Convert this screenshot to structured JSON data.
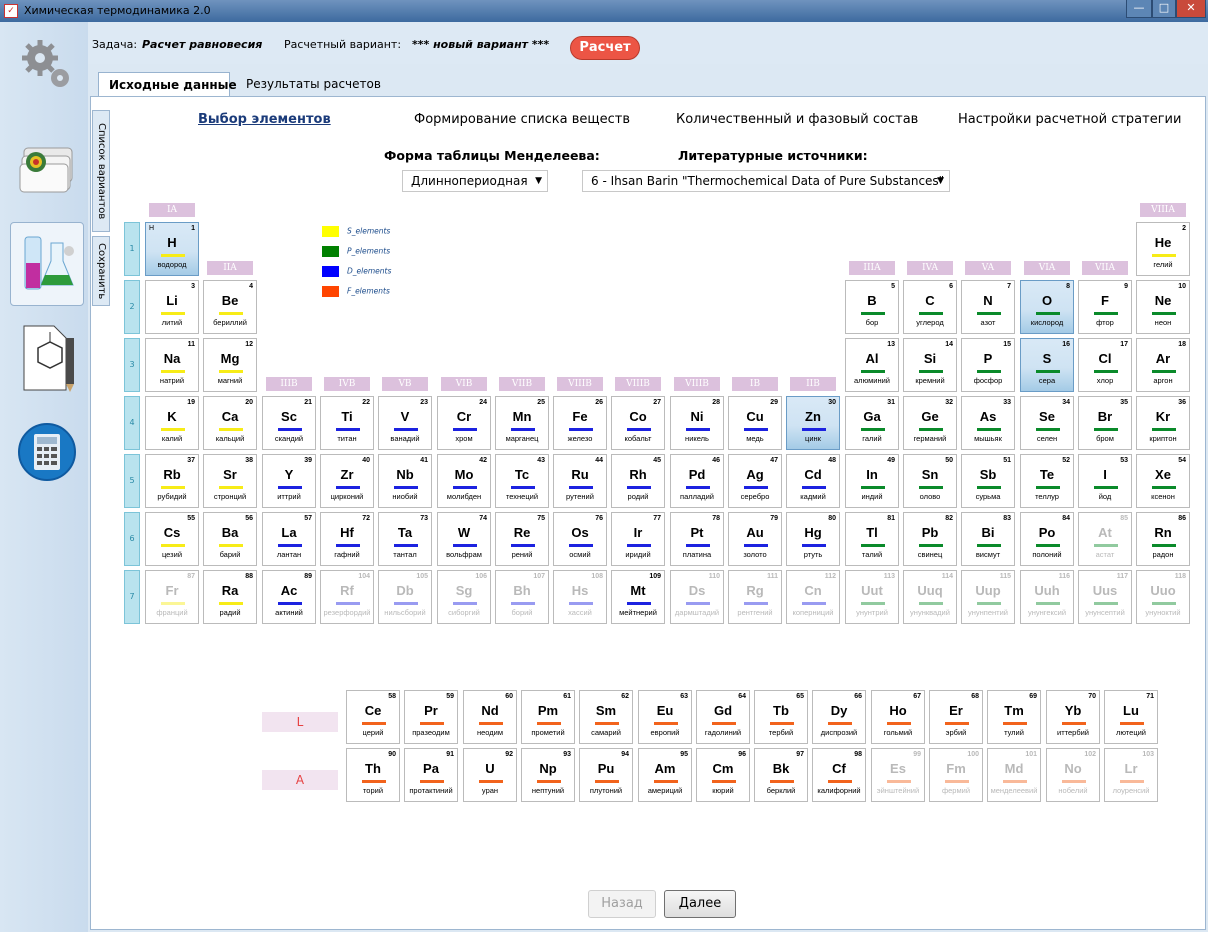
{
  "window": {
    "title": "Химическая термодинамика 2.0",
    "controls": [
      "—",
      "□",
      "✕"
    ]
  },
  "header": {
    "task_label": "Задача:",
    "task_value": "Расчет равновесия",
    "variant_label": "Расчетный вариант:",
    "variant_value": "*** новый вариант ***",
    "calc_button": "Расчет"
  },
  "sidebar": {
    "items": [
      {
        "icon": "gears-icon"
      },
      {
        "icon": "database-icon"
      },
      {
        "icon": "flasks-icon",
        "active": true
      },
      {
        "icon": "molecule-pencil-icon"
      },
      {
        "icon": "calculator-icon"
      }
    ]
  },
  "tabs": [
    {
      "label": "Исходные данные",
      "selected": true
    },
    {
      "label": "Результаты расчетов"
    }
  ],
  "side_tabs": [
    "Список вариантов",
    "Сохранить"
  ],
  "sections": [
    {
      "label": "Выбор элементов",
      "active": true
    },
    {
      "label": "Формирование списка веществ"
    },
    {
      "label": "Количественный и фазовый состав"
    },
    {
      "label": "Настройки расчетной стратегии"
    }
  ],
  "table_form": {
    "label": "Форма таблицы Менделеева:",
    "value": "Длиннопериодная"
  },
  "literature": {
    "label": "Литературные источники:",
    "value": "6 - Ihsan Barin \"Thermochemical Data of Pure Substances\""
  },
  "legend": [
    {
      "label": "S_elements",
      "color": "#ffff00"
    },
    {
      "label": "P_elements",
      "color": "#008000"
    },
    {
      "label": "D_elements",
      "color": "#0000ff"
    },
    {
      "label": "F_elements",
      "color": "#ff4500"
    }
  ],
  "colors": {
    "s": "#f7ec17",
    "p": "#0a8a2a",
    "d": "#1c22e0",
    "f": "#f2631c"
  },
  "groups": {
    "main": [
      "IA",
      "IIA",
      "IIIA",
      "IVA",
      "VA",
      "VIA",
      "VIIA",
      "VIIIA"
    ],
    "trans": [
      "IIIB",
      "IVB",
      "VB",
      "VIB",
      "VIIB",
      "VIIIB",
      "VIIIB",
      "VIIIB",
      "IB",
      "IIB"
    ]
  },
  "periods": [
    "1",
    "2",
    "3",
    "4",
    "5",
    "6",
    "7"
  ],
  "series": [
    "L",
    "A"
  ],
  "h_label": "H",
  "elements": [
    {
      "n": 1,
      "s": "H",
      "name": "водород",
      "p": 1,
      "g": 1,
      "b": "s",
      "sel": true
    },
    {
      "n": 2,
      "s": "He",
      "name": "гелий",
      "p": 1,
      "g": 18,
      "b": "s"
    },
    {
      "n": 3,
      "s": "Li",
      "name": "литий",
      "p": 2,
      "g": 1,
      "b": "s"
    },
    {
      "n": 4,
      "s": "Be",
      "name": "бериллий",
      "p": 2,
      "g": 2,
      "b": "s"
    },
    {
      "n": 5,
      "s": "B",
      "name": "бор",
      "p": 2,
      "g": 13,
      "b": "p"
    },
    {
      "n": 6,
      "s": "C",
      "name": "углерод",
      "p": 2,
      "g": 14,
      "b": "p"
    },
    {
      "n": 7,
      "s": "N",
      "name": "азот",
      "p": 2,
      "g": 15,
      "b": "p"
    },
    {
      "n": 8,
      "s": "O",
      "name": "кислород",
      "p": 2,
      "g": 16,
      "b": "p",
      "sel": true
    },
    {
      "n": 9,
      "s": "F",
      "name": "фтор",
      "p": 2,
      "g": 17,
      "b": "p"
    },
    {
      "n": 10,
      "s": "Ne",
      "name": "неон",
      "p": 2,
      "g": 18,
      "b": "p"
    },
    {
      "n": 11,
      "s": "Na",
      "name": "натрий",
      "p": 3,
      "g": 1,
      "b": "s"
    },
    {
      "n": 12,
      "s": "Mg",
      "name": "магний",
      "p": 3,
      "g": 2,
      "b": "s"
    },
    {
      "n": 13,
      "s": "Al",
      "name": "алюминий",
      "p": 3,
      "g": 13,
      "b": "p"
    },
    {
      "n": 14,
      "s": "Si",
      "name": "кремний",
      "p": 3,
      "g": 14,
      "b": "p"
    },
    {
      "n": 15,
      "s": "P",
      "name": "фосфор",
      "p": 3,
      "g": 15,
      "b": "p"
    },
    {
      "n": 16,
      "s": "S",
      "name": "сера",
      "p": 3,
      "g": 16,
      "b": "p",
      "sel": true
    },
    {
      "n": 17,
      "s": "Cl",
      "name": "хлор",
      "p": 3,
      "g": 17,
      "b": "p"
    },
    {
      "n": 18,
      "s": "Ar",
      "name": "аргон",
      "p": 3,
      "g": 18,
      "b": "p"
    },
    {
      "n": 19,
      "s": "K",
      "name": "калий",
      "p": 4,
      "g": 1,
      "b": "s"
    },
    {
      "n": 20,
      "s": "Ca",
      "name": "кальций",
      "p": 4,
      "g": 2,
      "b": "s"
    },
    {
      "n": 21,
      "s": "Sc",
      "name": "скандий",
      "p": 4,
      "g": 3,
      "b": "d"
    },
    {
      "n": 22,
      "s": "Ti",
      "name": "титан",
      "p": 4,
      "g": 4,
      "b": "d"
    },
    {
      "n": 23,
      "s": "V",
      "name": "ванадий",
      "p": 4,
      "g": 5,
      "b": "d"
    },
    {
      "n": 24,
      "s": "Cr",
      "name": "хром",
      "p": 4,
      "g": 6,
      "b": "d"
    },
    {
      "n": 25,
      "s": "Mn",
      "name": "марганец",
      "p": 4,
      "g": 7,
      "b": "d"
    },
    {
      "n": 26,
      "s": "Fe",
      "name": "железо",
      "p": 4,
      "g": 8,
      "b": "d"
    },
    {
      "n": 27,
      "s": "Co",
      "name": "кобальт",
      "p": 4,
      "g": 9,
      "b": "d"
    },
    {
      "n": 28,
      "s": "Ni",
      "name": "никель",
      "p": 4,
      "g": 10,
      "b": "d"
    },
    {
      "n": 29,
      "s": "Cu",
      "name": "медь",
      "p": 4,
      "g": 11,
      "b": "d"
    },
    {
      "n": 30,
      "s": "Zn",
      "name": "цинк",
      "p": 4,
      "g": 12,
      "b": "d",
      "sel": true
    },
    {
      "n": 31,
      "s": "Ga",
      "name": "галий",
      "p": 4,
      "g": 13,
      "b": "p"
    },
    {
      "n": 32,
      "s": "Ge",
      "name": "германий",
      "p": 4,
      "g": 14,
      "b": "p"
    },
    {
      "n": 33,
      "s": "As",
      "name": "мышьяк",
      "p": 4,
      "g": 15,
      "b": "p"
    },
    {
      "n": 34,
      "s": "Se",
      "name": "селен",
      "p": 4,
      "g": 16,
      "b": "p"
    },
    {
      "n": 35,
      "s": "Br",
      "name": "бром",
      "p": 4,
      "g": 17,
      "b": "p"
    },
    {
      "n": 36,
      "s": "Kr",
      "name": "криптон",
      "p": 4,
      "g": 18,
      "b": "p"
    },
    {
      "n": 37,
      "s": "Rb",
      "name": "рубидий",
      "p": 5,
      "g": 1,
      "b": "s"
    },
    {
      "n": 38,
      "s": "Sr",
      "name": "стронций",
      "p": 5,
      "g": 2,
      "b": "s"
    },
    {
      "n": 39,
      "s": "Y",
      "name": "иттрий",
      "p": 5,
      "g": 3,
      "b": "d"
    },
    {
      "n": 40,
      "s": "Zr",
      "name": "цирконий",
      "p": 5,
      "g": 4,
      "b": "d"
    },
    {
      "n": 41,
      "s": "Nb",
      "name": "ниобий",
      "p": 5,
      "g": 5,
      "b": "d"
    },
    {
      "n": 42,
      "s": "Mo",
      "name": "молибден",
      "p": 5,
      "g": 6,
      "b": "d"
    },
    {
      "n": 43,
      "s": "Tc",
      "name": "технеций",
      "p": 5,
      "g": 7,
      "b": "d"
    },
    {
      "n": 44,
      "s": "Ru",
      "name": "рутений",
      "p": 5,
      "g": 8,
      "b": "d"
    },
    {
      "n": 45,
      "s": "Rh",
      "name": "родий",
      "p": 5,
      "g": 9,
      "b": "d"
    },
    {
      "n": 46,
      "s": "Pd",
      "name": "палладий",
      "p": 5,
      "g": 10,
      "b": "d"
    },
    {
      "n": 47,
      "s": "Ag",
      "name": "серебро",
      "p": 5,
      "g": 11,
      "b": "d"
    },
    {
      "n": 48,
      "s": "Cd",
      "name": "кадмий",
      "p": 5,
      "g": 12,
      "b": "d"
    },
    {
      "n": 49,
      "s": "In",
      "name": "индий",
      "p": 5,
      "g": 13,
      "b": "p"
    },
    {
      "n": 50,
      "s": "Sn",
      "name": "олово",
      "p": 5,
      "g": 14,
      "b": "p"
    },
    {
      "n": 51,
      "s": "Sb",
      "name": "сурьма",
      "p": 5,
      "g": 15,
      "b": "p"
    },
    {
      "n": 52,
      "s": "Te",
      "name": "теллур",
      "p": 5,
      "g": 16,
      "b": "p"
    },
    {
      "n": 53,
      "s": "I",
      "name": "йод",
      "p": 5,
      "g": 17,
      "b": "p"
    },
    {
      "n": 54,
      "s": "Xe",
      "name": "ксенон",
      "p": 5,
      "g": 18,
      "b": "p"
    },
    {
      "n": 55,
      "s": "Cs",
      "name": "цезий",
      "p": 6,
      "g": 1,
      "b": "s"
    },
    {
      "n": 56,
      "s": "Ba",
      "name": "барий",
      "p": 6,
      "g": 2,
      "b": "s"
    },
    {
      "n": 57,
      "s": "La",
      "name": "лантан",
      "p": 6,
      "g": 3,
      "b": "d"
    },
    {
      "n": 72,
      "s": "Hf",
      "name": "гафний",
      "p": 6,
      "g": 4,
      "b": "d"
    },
    {
      "n": 73,
      "s": "Ta",
      "name": "тантал",
      "p": 6,
      "g": 5,
      "b": "d"
    },
    {
      "n": 74,
      "s": "W",
      "name": "вольфрам",
      "p": 6,
      "g": 6,
      "b": "d"
    },
    {
      "n": 75,
      "s": "Re",
      "name": "рений",
      "p": 6,
      "g": 7,
      "b": "d"
    },
    {
      "n": 76,
      "s": "Os",
      "name": "осмий",
      "p": 6,
      "g": 8,
      "b": "d"
    },
    {
      "n": 77,
      "s": "Ir",
      "name": "иридий",
      "p": 6,
      "g": 9,
      "b": "d"
    },
    {
      "n": 78,
      "s": "Pt",
      "name": "платина",
      "p": 6,
      "g": 10,
      "b": "d"
    },
    {
      "n": 79,
      "s": "Au",
      "name": "золото",
      "p": 6,
      "g": 11,
      "b": "d"
    },
    {
      "n": 80,
      "s": "Hg",
      "name": "ртуть",
      "p": 6,
      "g": 12,
      "b": "d"
    },
    {
      "n": 81,
      "s": "Tl",
      "name": "талий",
      "p": 6,
      "g": 13,
      "b": "p"
    },
    {
      "n": 82,
      "s": "Pb",
      "name": "свинец",
      "p": 6,
      "g": 14,
      "b": "p"
    },
    {
      "n": 83,
      "s": "Bi",
      "name": "висмут",
      "p": 6,
      "g": 15,
      "b": "p"
    },
    {
      "n": 84,
      "s": "Po",
      "name": "полоний",
      "p": 6,
      "g": 16,
      "b": "p"
    },
    {
      "n": 85,
      "s": "At",
      "name": "астат",
      "p": 6,
      "g": 17,
      "b": "p",
      "dis": true
    },
    {
      "n": 86,
      "s": "Rn",
      "name": "радон",
      "p": 6,
      "g": 18,
      "b": "p"
    },
    {
      "n": 87,
      "s": "Fr",
      "name": "франций",
      "p": 7,
      "g": 1,
      "b": "s",
      "dis": true
    },
    {
      "n": 88,
      "s": "Ra",
      "name": "радий",
      "p": 7,
      "g": 2,
      "b": "s"
    },
    {
      "n": 89,
      "s": "Ac",
      "name": "актиний",
      "p": 7,
      "g": 3,
      "b": "d"
    },
    {
      "n": 104,
      "s": "Rf",
      "name": "резерфордий",
      "p": 7,
      "g": 4,
      "b": "d",
      "dis": true
    },
    {
      "n": 105,
      "s": "Db",
      "name": "нильсборий",
      "p": 7,
      "g": 5,
      "b": "d",
      "dis": true
    },
    {
      "n": 106,
      "s": "Sg",
      "name": "сиборгий",
      "p": 7,
      "g": 6,
      "b": "d",
      "dis": true
    },
    {
      "n": 107,
      "s": "Bh",
      "name": "борий",
      "p": 7,
      "g": 7,
      "b": "d",
      "dis": true
    },
    {
      "n": 108,
      "s": "Hs",
      "name": "хассий",
      "p": 7,
      "g": 8,
      "b": "d",
      "dis": true
    },
    {
      "n": 109,
      "s": "Mt",
      "name": "мейтнерий",
      "p": 7,
      "g": 9,
      "b": "d"
    },
    {
      "n": 110,
      "s": "Ds",
      "name": "дармштадий",
      "p": 7,
      "g": 10,
      "b": "d",
      "dis": true
    },
    {
      "n": 111,
      "s": "Rg",
      "name": "рентгений",
      "p": 7,
      "g": 11,
      "b": "d",
      "dis": true
    },
    {
      "n": 112,
      "s": "Cn",
      "name": "коперниций",
      "p": 7,
      "g": 12,
      "b": "d",
      "dis": true
    },
    {
      "n": 113,
      "s": "Uut",
      "name": "унунтрий",
      "p": 7,
      "g": 13,
      "b": "p",
      "dis": true
    },
    {
      "n": 114,
      "s": "Uuq",
      "name": "унунквадий",
      "p": 7,
      "g": 14,
      "b": "p",
      "dis": true
    },
    {
      "n": 115,
      "s": "Uup",
      "name": "унунпентий",
      "p": 7,
      "g": 15,
      "b": "p",
      "dis": true
    },
    {
      "n": 116,
      "s": "Uuh",
      "name": "унунгексий",
      "p": 7,
      "g": 16,
      "b": "p",
      "dis": true
    },
    {
      "n": 117,
      "s": "Uus",
      "name": "унунсептий",
      "p": 7,
      "g": 17,
      "b": "p",
      "dis": true
    },
    {
      "n": 118,
      "s": "Uuo",
      "name": "унуноктий",
      "p": 7,
      "g": 18,
      "b": "p",
      "dis": true
    },
    {
      "n": 58,
      "s": "Ce",
      "name": "церий",
      "p": 8,
      "g": 1,
      "b": "f"
    },
    {
      "n": 59,
      "s": "Pr",
      "name": "празеодим",
      "p": 8,
      "g": 2,
      "b": "f"
    },
    {
      "n": 60,
      "s": "Nd",
      "name": "неодим",
      "p": 8,
      "g": 3,
      "b": "f"
    },
    {
      "n": 61,
      "s": "Pm",
      "name": "прометий",
      "p": 8,
      "g": 4,
      "b": "f"
    },
    {
      "n": 62,
      "s": "Sm",
      "name": "самарий",
      "p": 8,
      "g": 5,
      "b": "f"
    },
    {
      "n": 63,
      "s": "Eu",
      "name": "европий",
      "p": 8,
      "g": 6,
      "b": "f"
    },
    {
      "n": 64,
      "s": "Gd",
      "name": "гадолиний",
      "p": 8,
      "g": 7,
      "b": "f"
    },
    {
      "n": 65,
      "s": "Tb",
      "name": "тербий",
      "p": 8,
      "g": 8,
      "b": "f"
    },
    {
      "n": 66,
      "s": "Dy",
      "name": "диспрозий",
      "p": 8,
      "g": 9,
      "b": "f"
    },
    {
      "n": 67,
      "s": "Ho",
      "name": "гольмий",
      "p": 8,
      "g": 10,
      "b": "f"
    },
    {
      "n": 68,
      "s": "Er",
      "name": "эрбий",
      "p": 8,
      "g": 11,
      "b": "f"
    },
    {
      "n": 69,
      "s": "Tm",
      "name": "тулий",
      "p": 8,
      "g": 12,
      "b": "f"
    },
    {
      "n": 70,
      "s": "Yb",
      "name": "иттербий",
      "p": 8,
      "g": 13,
      "b": "f"
    },
    {
      "n": 71,
      "s": "Lu",
      "name": "лютеций",
      "p": 8,
      "g": 14,
      "b": "f"
    },
    {
      "n": 90,
      "s": "Th",
      "name": "торий",
      "p": 9,
      "g": 1,
      "b": "f"
    },
    {
      "n": 91,
      "s": "Pa",
      "name": "протактиний",
      "p": 9,
      "g": 2,
      "b": "f"
    },
    {
      "n": 92,
      "s": "U",
      "name": "уран",
      "p": 9,
      "g": 3,
      "b": "f"
    },
    {
      "n": 93,
      "s": "Np",
      "name": "нептуний",
      "p": 9,
      "g": 4,
      "b": "f"
    },
    {
      "n": 94,
      "s": "Pu",
      "name": "плутоний",
      "p": 9,
      "g": 5,
      "b": "f"
    },
    {
      "n": 95,
      "s": "Am",
      "name": "америций",
      "p": 9,
      "g": 6,
      "b": "f"
    },
    {
      "n": 96,
      "s": "Cm",
      "name": "кюрий",
      "p": 9,
      "g": 7,
      "b": "f"
    },
    {
      "n": 97,
      "s": "Bk",
      "name": "берклий",
      "p": 9,
      "g": 8,
      "b": "f"
    },
    {
      "n": 98,
      "s": "Cf",
      "name": "калифорний",
      "p": 9,
      "g": 9,
      "b": "f"
    },
    {
      "n": 99,
      "s": "Es",
      "name": "эйнштейний",
      "p": 9,
      "g": 10,
      "b": "f",
      "dis": true
    },
    {
      "n": 100,
      "s": "Fm",
      "name": "фермий",
      "p": 9,
      "g": 11,
      "b": "f",
      "dis": true
    },
    {
      "n": 101,
      "s": "Md",
      "name": "менделеевий",
      "p": 9,
      "g": 12,
      "b": "f",
      "dis": true
    },
    {
      "n": 102,
      "s": "No",
      "name": "нобелий",
      "p": 9,
      "g": 13,
      "b": "f",
      "dis": true
    },
    {
      "n": 103,
      "s": "Lr",
      "name": "лоуренсий",
      "p": 9,
      "g": 14,
      "b": "f",
      "dis": true
    }
  ],
  "nav": {
    "back": "Назад",
    "next": "Далее"
  }
}
